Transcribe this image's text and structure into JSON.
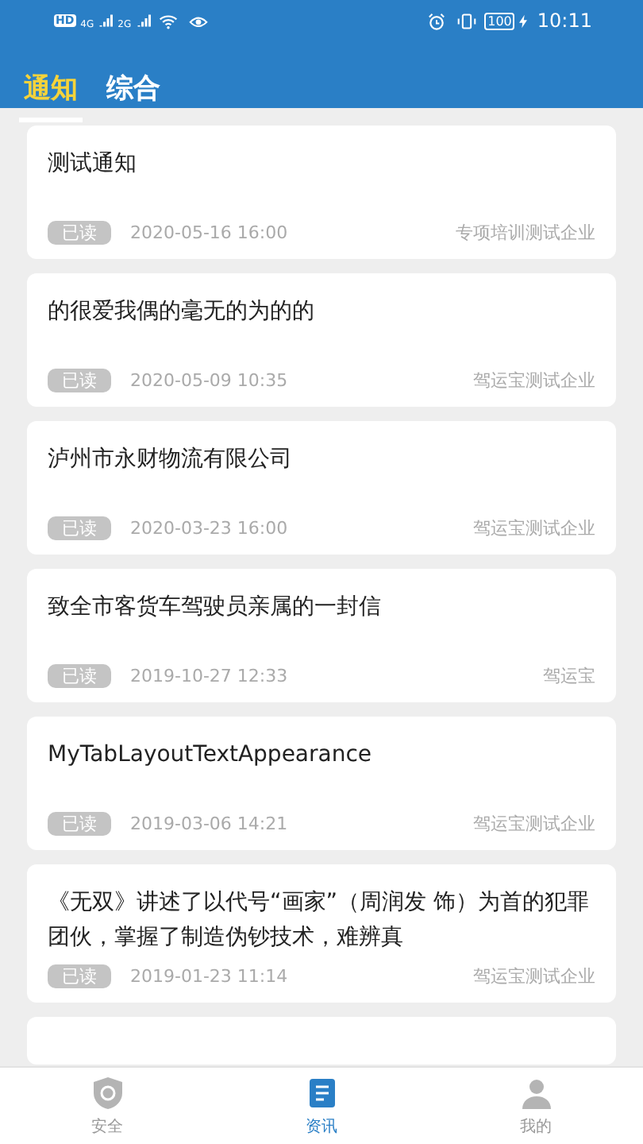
{
  "status_bar": {
    "hd": "HD",
    "net_1": "4G",
    "net_2": "2G",
    "battery": "100",
    "time": "10:11"
  },
  "tabs": [
    {
      "label": "通知",
      "selected": true
    },
    {
      "label": "综合",
      "selected": false
    }
  ],
  "notices": [
    {
      "title": "测试通知",
      "badge": "已读",
      "date": "2020-05-16 16:00",
      "source": "专项培训测试企业"
    },
    {
      "title": "的很爱我偶的毫无的为的的",
      "badge": "已读",
      "date": "2020-05-09 10:35",
      "source": "驾运宝测试企业"
    },
    {
      "title": "泸州市永财物流有限公司",
      "badge": "已读",
      "date": "2020-03-23 16:00",
      "source": "驾运宝测试企业"
    },
    {
      "title": "致全市客货车驾驶员亲属的一封信",
      "badge": "已读",
      "date": "2019-10-27 12:33",
      "source": "驾运宝"
    },
    {
      "title": "MyTabLayoutTextAppearance",
      "badge": "已读",
      "date": "2019-03-06 14:21",
      "source": "驾运宝测试企业"
    },
    {
      "title": "《无双》讲述了以代号“画家”（周润发 饰）为首的犯罪团伙，掌握了制造伪钞技术，难辨真",
      "badge": "已读",
      "date": "2019-01-23 11:14",
      "source": "驾运宝测试企业"
    }
  ],
  "bottom_nav": [
    {
      "label": "安全",
      "kind": "shield",
      "selected": false
    },
    {
      "label": "资讯",
      "kind": "news",
      "selected": true
    },
    {
      "label": "我的",
      "kind": "person",
      "selected": false
    }
  ]
}
